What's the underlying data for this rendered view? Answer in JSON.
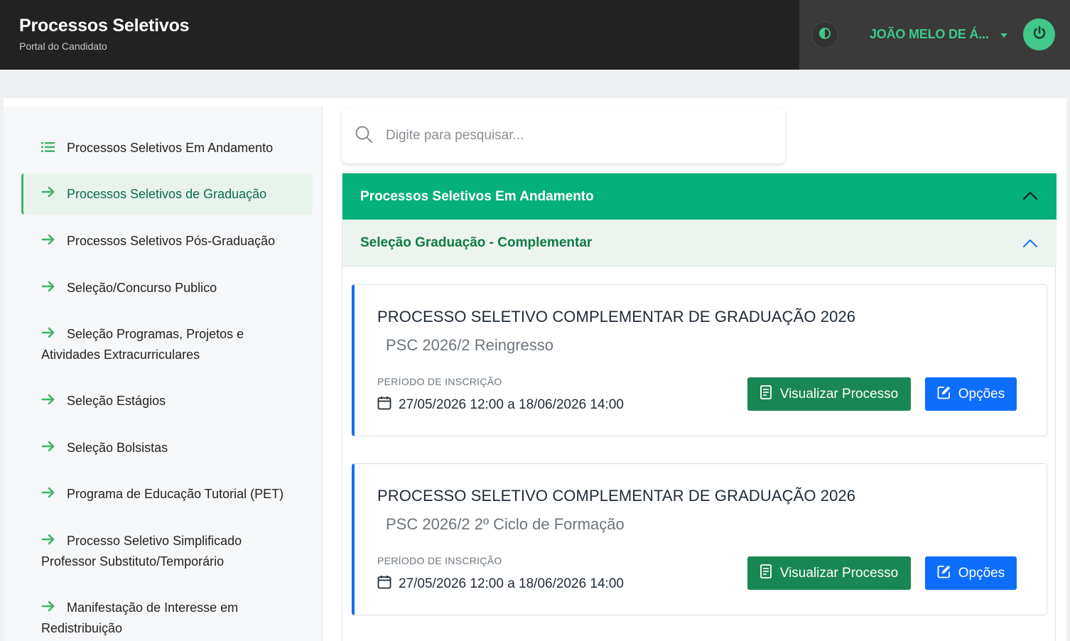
{
  "header": {
    "title": "Processos Seletivos",
    "subtitle": "Portal do Candidato",
    "user_name": "JOÃO MELO DE Á...",
    "colors": {
      "bar": "#222222",
      "accent": "#3fc88a"
    }
  },
  "sidebar": {
    "items": [
      {
        "label": "Processos Seletivos Em Andamento",
        "icon": "list-icon"
      },
      {
        "label": "Processos Seletivos de Graduação",
        "icon": "arrow-right-icon",
        "active": true
      },
      {
        "label": "Processos Seletivos Pós-Graduação",
        "icon": "arrow-right-icon"
      },
      {
        "label": "Seleção/Concurso Publico",
        "icon": "arrow-right-icon"
      },
      {
        "label": "Seleção Programas, Projetos e Atividades Extracurriculares",
        "icon": "arrow-right-icon"
      },
      {
        "label": "Seleção Estágios",
        "icon": "arrow-right-icon"
      },
      {
        "label": "Seleção Bolsistas",
        "icon": "arrow-right-icon"
      },
      {
        "label": "Programa de Educação Tutorial (PET)",
        "icon": "arrow-right-icon"
      },
      {
        "label": "Processo Seletivo Simplificado Professor Substituto/Temporário",
        "icon": "arrow-right-icon"
      },
      {
        "label": "Manifestação de Interesse em Redistribuição",
        "icon": "arrow-right-icon"
      }
    ]
  },
  "search": {
    "placeholder": "Digite para pesquisar..."
  },
  "main": {
    "section_title": "Processos Seletivos Em Andamento",
    "group_title": "Seleção Graduação - Complementar",
    "period_label": "PERÍODO DE INSCRIÇÃO",
    "view_label": "Visualizar Processo",
    "options_label": "Opções",
    "cards": [
      {
        "title": "PROCESSO SELETIVO COMPLEMENTAR DE GRADUAÇÃO 2026",
        "subtitle": "PSC 2026/2 Reingresso",
        "period": "27/05/2026 12:00 a 18/06/2026 14:00"
      },
      {
        "title": "PROCESSO SELETIVO COMPLEMENTAR DE GRADUAÇÃO 2026",
        "subtitle": "PSC 2026/2 2º Ciclo de Formação",
        "period": "27/05/2026 12:00 a 18/06/2026 14:00"
      }
    ],
    "colors": {
      "section": "#06b07a",
      "group_text": "#0f7a44",
      "view_button": "#198754",
      "options_button": "#0d6efd",
      "card_accent": "#1570ef"
    }
  }
}
